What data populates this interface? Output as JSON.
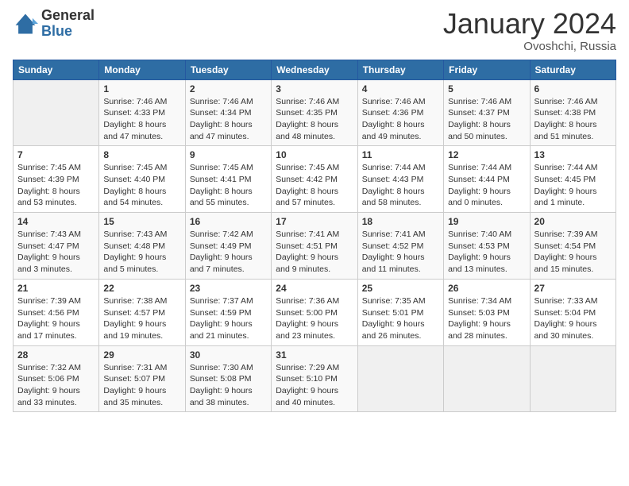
{
  "header": {
    "logo_general": "General",
    "logo_blue": "Blue",
    "month_title": "January 2024",
    "location": "Ovoshchi, Russia"
  },
  "weekdays": [
    "Sunday",
    "Monday",
    "Tuesday",
    "Wednesday",
    "Thursday",
    "Friday",
    "Saturday"
  ],
  "weeks": [
    [
      {
        "day": "",
        "empty": true
      },
      {
        "day": "1",
        "sunrise": "Sunrise: 7:46 AM",
        "sunset": "Sunset: 4:33 PM",
        "daylight": "Daylight: 8 hours and 47 minutes."
      },
      {
        "day": "2",
        "sunrise": "Sunrise: 7:46 AM",
        "sunset": "Sunset: 4:34 PM",
        "daylight": "Daylight: 8 hours and 47 minutes."
      },
      {
        "day": "3",
        "sunrise": "Sunrise: 7:46 AM",
        "sunset": "Sunset: 4:35 PM",
        "daylight": "Daylight: 8 hours and 48 minutes."
      },
      {
        "day": "4",
        "sunrise": "Sunrise: 7:46 AM",
        "sunset": "Sunset: 4:36 PM",
        "daylight": "Daylight: 8 hours and 49 minutes."
      },
      {
        "day": "5",
        "sunrise": "Sunrise: 7:46 AM",
        "sunset": "Sunset: 4:37 PM",
        "daylight": "Daylight: 8 hours and 50 minutes."
      },
      {
        "day": "6",
        "sunrise": "Sunrise: 7:46 AM",
        "sunset": "Sunset: 4:38 PM",
        "daylight": "Daylight: 8 hours and 51 minutes."
      }
    ],
    [
      {
        "day": "7",
        "sunrise": "Sunrise: 7:45 AM",
        "sunset": "Sunset: 4:39 PM",
        "daylight": "Daylight: 8 hours and 53 minutes."
      },
      {
        "day": "8",
        "sunrise": "Sunrise: 7:45 AM",
        "sunset": "Sunset: 4:40 PM",
        "daylight": "Daylight: 8 hours and 54 minutes."
      },
      {
        "day": "9",
        "sunrise": "Sunrise: 7:45 AM",
        "sunset": "Sunset: 4:41 PM",
        "daylight": "Daylight: 8 hours and 55 minutes."
      },
      {
        "day": "10",
        "sunrise": "Sunrise: 7:45 AM",
        "sunset": "Sunset: 4:42 PM",
        "daylight": "Daylight: 8 hours and 57 minutes."
      },
      {
        "day": "11",
        "sunrise": "Sunrise: 7:44 AM",
        "sunset": "Sunset: 4:43 PM",
        "daylight": "Daylight: 8 hours and 58 minutes."
      },
      {
        "day": "12",
        "sunrise": "Sunrise: 7:44 AM",
        "sunset": "Sunset: 4:44 PM",
        "daylight": "Daylight: 9 hours and 0 minutes."
      },
      {
        "day": "13",
        "sunrise": "Sunrise: 7:44 AM",
        "sunset": "Sunset: 4:45 PM",
        "daylight": "Daylight: 9 hours and 1 minute."
      }
    ],
    [
      {
        "day": "14",
        "sunrise": "Sunrise: 7:43 AM",
        "sunset": "Sunset: 4:47 PM",
        "daylight": "Daylight: 9 hours and 3 minutes."
      },
      {
        "day": "15",
        "sunrise": "Sunrise: 7:43 AM",
        "sunset": "Sunset: 4:48 PM",
        "daylight": "Daylight: 9 hours and 5 minutes."
      },
      {
        "day": "16",
        "sunrise": "Sunrise: 7:42 AM",
        "sunset": "Sunset: 4:49 PM",
        "daylight": "Daylight: 9 hours and 7 minutes."
      },
      {
        "day": "17",
        "sunrise": "Sunrise: 7:41 AM",
        "sunset": "Sunset: 4:51 PM",
        "daylight": "Daylight: 9 hours and 9 minutes."
      },
      {
        "day": "18",
        "sunrise": "Sunrise: 7:41 AM",
        "sunset": "Sunset: 4:52 PM",
        "daylight": "Daylight: 9 hours and 11 minutes."
      },
      {
        "day": "19",
        "sunrise": "Sunrise: 7:40 AM",
        "sunset": "Sunset: 4:53 PM",
        "daylight": "Daylight: 9 hours and 13 minutes."
      },
      {
        "day": "20",
        "sunrise": "Sunrise: 7:39 AM",
        "sunset": "Sunset: 4:54 PM",
        "daylight": "Daylight: 9 hours and 15 minutes."
      }
    ],
    [
      {
        "day": "21",
        "sunrise": "Sunrise: 7:39 AM",
        "sunset": "Sunset: 4:56 PM",
        "daylight": "Daylight: 9 hours and 17 minutes."
      },
      {
        "day": "22",
        "sunrise": "Sunrise: 7:38 AM",
        "sunset": "Sunset: 4:57 PM",
        "daylight": "Daylight: 9 hours and 19 minutes."
      },
      {
        "day": "23",
        "sunrise": "Sunrise: 7:37 AM",
        "sunset": "Sunset: 4:59 PM",
        "daylight": "Daylight: 9 hours and 21 minutes."
      },
      {
        "day": "24",
        "sunrise": "Sunrise: 7:36 AM",
        "sunset": "Sunset: 5:00 PM",
        "daylight": "Daylight: 9 hours and 23 minutes."
      },
      {
        "day": "25",
        "sunrise": "Sunrise: 7:35 AM",
        "sunset": "Sunset: 5:01 PM",
        "daylight": "Daylight: 9 hours and 26 minutes."
      },
      {
        "day": "26",
        "sunrise": "Sunrise: 7:34 AM",
        "sunset": "Sunset: 5:03 PM",
        "daylight": "Daylight: 9 hours and 28 minutes."
      },
      {
        "day": "27",
        "sunrise": "Sunrise: 7:33 AM",
        "sunset": "Sunset: 5:04 PM",
        "daylight": "Daylight: 9 hours and 30 minutes."
      }
    ],
    [
      {
        "day": "28",
        "sunrise": "Sunrise: 7:32 AM",
        "sunset": "Sunset: 5:06 PM",
        "daylight": "Daylight: 9 hours and 33 minutes."
      },
      {
        "day": "29",
        "sunrise": "Sunrise: 7:31 AM",
        "sunset": "Sunset: 5:07 PM",
        "daylight": "Daylight: 9 hours and 35 minutes."
      },
      {
        "day": "30",
        "sunrise": "Sunrise: 7:30 AM",
        "sunset": "Sunset: 5:08 PM",
        "daylight": "Daylight: 9 hours and 38 minutes."
      },
      {
        "day": "31",
        "sunrise": "Sunrise: 7:29 AM",
        "sunset": "Sunset: 5:10 PM",
        "daylight": "Daylight: 9 hours and 40 minutes."
      },
      {
        "day": "",
        "empty": true
      },
      {
        "day": "",
        "empty": true
      },
      {
        "day": "",
        "empty": true
      }
    ]
  ]
}
